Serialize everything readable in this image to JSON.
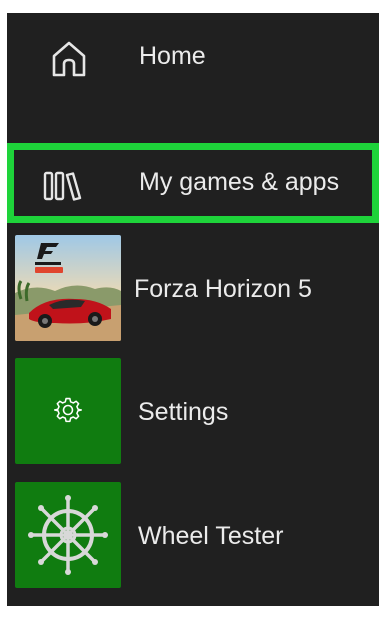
{
  "nav": {
    "home": {
      "label": "Home",
      "icon": "home-icon"
    },
    "my_games": {
      "label": "My games & apps",
      "icon": "library-icon",
      "selected": true,
      "highlight_color": "#1ed33a"
    },
    "forza": {
      "label": "Forza Horizon 5",
      "icon": "forza-horizon-5-thumbnail"
    },
    "settings": {
      "label": "Settings",
      "icon": "gear-icon",
      "tile_color": "#107c10"
    },
    "wheel_tester": {
      "label": "Wheel Tester",
      "icon": "ship-wheel-icon",
      "tile_color": "#107c10"
    }
  },
  "colors": {
    "panel_bg": "#202020",
    "text": "#ebebeb",
    "xbox_green": "#107c10"
  }
}
